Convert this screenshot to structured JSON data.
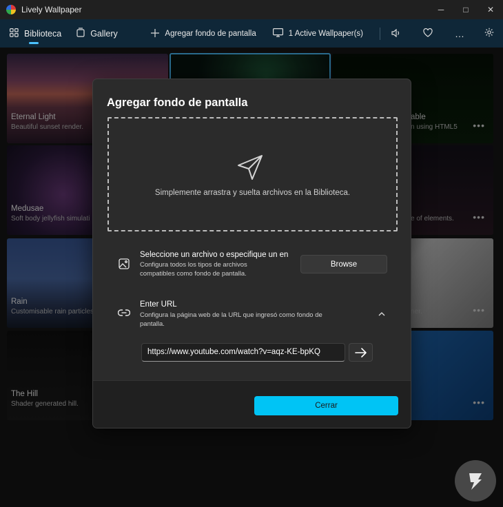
{
  "window": {
    "title": "Lively Wallpaper"
  },
  "nav": {
    "library": "Biblioteca",
    "gallery": "Gallery",
    "add_wallpaper": "Agregar fondo de pantalla",
    "active_wallpapers": "1 Active Wallpaper(s)"
  },
  "cards": [
    {
      "title": "Eternal Light",
      "desc": "Beautiful sunset render."
    },
    {
      "title": "Medusae",
      "desc": "Soft body jellyfish simulati"
    },
    {
      "title": "Rain",
      "desc": "Customisable rain particles"
    },
    {
      "title": "The Hill",
      "desc": "Shader generated hill."
    },
    {
      "title": "able",
      "desc": "n using HTML5"
    },
    {
      "desc": "e of elements."
    },
    {
      "desc": "ner."
    }
  ],
  "dialog": {
    "title": "Agregar fondo de pantalla",
    "drop_text": "Simplemente arrastra y suelta archivos en la Biblioteca.",
    "file_title": "Seleccione un archivo o especifique un en",
    "file_desc_1": "Configura todos los tipos de archivos",
    "file_desc_2": "compatibles como fondo de pantalla.",
    "browse": "Browse",
    "url_title": "Enter URL",
    "url_desc_1": "Configura la página web de la URL que ingresó como fondo de",
    "url_desc_2": "pantalla.",
    "url_value": "https://www.youtube.com/watch?v=aqz-KE-bpKQ",
    "close": "Cerrar"
  },
  "colors": {
    "accent": "#00c4f5",
    "nav_bg": "#0f2738",
    "dialog_bg": "#2b2b2b"
  },
  "icons": [
    "app-logo-icon",
    "grid-icon",
    "gallery-icon",
    "plus-icon",
    "monitor-icon",
    "volume-icon",
    "heart-icon",
    "more-icon",
    "gear-icon",
    "send-icon",
    "image-icon",
    "link-icon",
    "chevron-up-icon",
    "arrow-right-icon",
    "ellipsis-icon"
  ]
}
